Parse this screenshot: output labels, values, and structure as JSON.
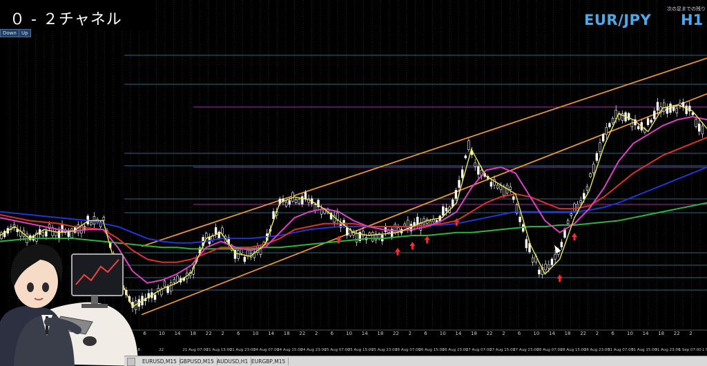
{
  "window": {
    "title": "０ - ２チャネル",
    "symbol": "EUR/JPY",
    "timeframe": "H1",
    "top_note": "次の足までの残り",
    "buttons": [
      "Down",
      "Up"
    ]
  },
  "tabs": [
    "EURUSD,M15",
    "GBPUSD,M15",
    "AUDUSD,H1",
    "EURGBP,M15"
  ],
  "colors": {
    "background": "#000000",
    "grid": "#3a3a3a",
    "candle": "#ffffff",
    "ma_yellow": "#f2ea3c",
    "ma_magenta": "#e040c8",
    "ma_red": "#e0302a",
    "ma_blue": "#1f36d8",
    "ma_green": "#29b83a",
    "channel": "#e8962c",
    "level_cyan": "#2f8fae",
    "level_magenta": "#a82aa8",
    "arrow_up": "#ff2a2a",
    "symbol": "#4fa9e8"
  },
  "chart_data": {
    "type": "line",
    "x_tick_labels": [
      "18",
      "22",
      "21 Aug 07:00",
      "21 Aug 15:00",
      "21 Aug 23:00",
      "24 Aug 07:00",
      "24 Aug 15:00",
      "24 Aug 23:00",
      "25 Aug 07:00",
      "25 Aug 15:00",
      "25 Aug 23:00",
      "26 Aug 07:00",
      "26 Aug 15:00",
      "26 Aug 23:00",
      "27 Aug 07:00",
      "27 Aug 15:00",
      "27 Aug 23:00",
      "28 Aug 07:00",
      "28 Aug 15:00",
      "28 Aug 23:00",
      "31 Aug 07:00",
      "31 Aug 15:00",
      "31 Aug 23:00",
      "1 Sep 07:00",
      "1 Sep 15:00"
    ],
    "x_hour_labels": [
      "18",
      "22",
      "2",
      "6",
      "10",
      "14",
      "18",
      "22",
      "2",
      "6",
      "10",
      "14",
      "18",
      "22",
      "2",
      "6",
      "10",
      "14",
      "18",
      "22",
      "2",
      "6",
      "10",
      "14",
      "18",
      "22",
      "2",
      "6",
      "10",
      "14",
      "18",
      "22",
      "2",
      "6",
      "10",
      "14",
      "18",
      "22",
      "2",
      "6",
      "10",
      "14",
      "18",
      "22",
      "2"
    ],
    "series": [
      {
        "name": "",
        "color_key": "ma_yellow",
        "values": [
          60,
          66,
          58,
          64,
          62,
          63,
          70,
          70,
          34,
          12,
          18,
          24,
          28,
          35,
          58,
          62,
          48,
          46,
          54,
          82,
          86,
          84,
          78,
          70,
          62,
          60,
          61,
          62,
          66,
          70,
          72,
          82,
          118,
          100,
          94,
          88,
          54,
          34,
          44,
          72,
          90,
          120,
          142,
          138,
          130,
          146,
          148,
          144,
          132
        ]
      },
      {
        "name": "",
        "color_key": "ma_magenta",
        "values": [
          72,
          70,
          68,
          66,
          64,
          63,
          64,
          64,
          52,
          36,
          28,
          30,
          34,
          40,
          52,
          56,
          52,
          50,
          52,
          62,
          72,
          76,
          78,
          76,
          70,
          66,
          64,
          63,
          64,
          66,
          70,
          76,
          92,
          104,
          106,
          102,
          86,
          70,
          62,
          68,
          78,
          92,
          110,
          122,
          128,
          134,
          138,
          140,
          138
        ]
      },
      {
        "name": "",
        "color_key": "ma_red",
        "values": [
          74,
          72,
          70,
          69,
          68,
          66,
          65,
          64,
          58,
          50,
          44,
          42,
          42,
          44,
          48,
          52,
          52,
          52,
          54,
          58,
          64,
          66,
          68,
          68,
          68,
          66,
          66,
          66,
          66,
          67,
          68,
          70,
          76,
          82,
          86,
          88,
          86,
          82,
          78,
          78,
          80,
          86,
          94,
          102,
          108,
          114,
          118,
          122,
          126
        ]
      },
      {
        "name": "",
        "color_key": "ma_blue",
        "values": [
          76,
          75,
          74,
          73,
          72,
          71,
          70,
          68,
          66,
          62,
          58,
          56,
          55,
          55,
          56,
          58,
          58,
          58,
          59,
          60,
          62,
          64,
          65,
          66,
          66,
          66,
          66,
          66,
          66,
          67,
          67,
          68,
          70,
          72,
          74,
          76,
          76,
          76,
          76,
          76,
          77,
          79,
          82,
          86,
          90,
          94,
          98,
          102,
          106
        ]
      },
      {
        "name": "",
        "color_key": "ma_green",
        "values": [
          56,
          57,
          58,
          58,
          58,
          58,
          57,
          56,
          55,
          54,
          53,
          52,
          52,
          51,
          51,
          51,
          51,
          51,
          52,
          52,
          53,
          54,
          55,
          56,
          57,
          58,
          58,
          59,
          60,
          60,
          61,
          62,
          62,
          63,
          64,
          65,
          66,
          66,
          67,
          67,
          68,
          69,
          70,
          72,
          74,
          76,
          78,
          80,
          82
        ]
      }
    ],
    "channel_lines": [
      {
        "from": [
          0,
          2
        ],
        "to": [
          48,
          148
        ]
      },
      {
        "from": [
          0,
          48
        ],
        "to": [
          48,
          172
        ]
      }
    ],
    "signal_arrows_up_at": [
      23,
      27,
      28,
      29,
      31,
      38,
      39
    ],
    "ylim": [
      0,
      200
    ],
    "grid": true,
    "legend": "none"
  }
}
